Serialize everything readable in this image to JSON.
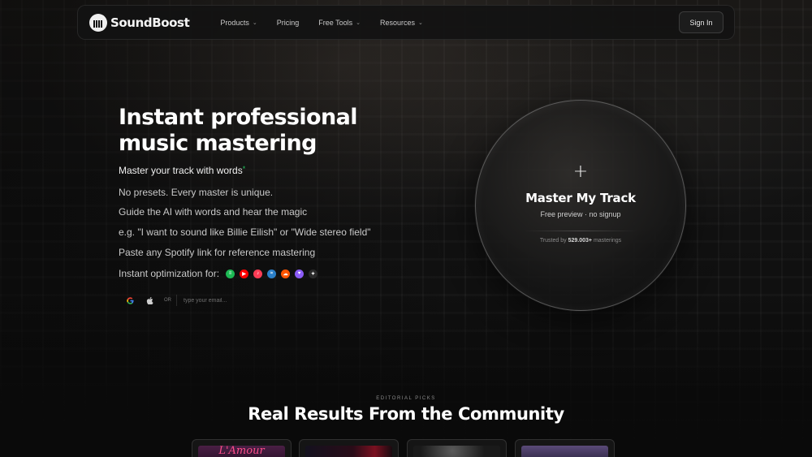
{
  "nav": {
    "brand": "SoundBoost",
    "items": [
      {
        "label": "Products",
        "has_dropdown": true
      },
      {
        "label": "Pricing",
        "has_dropdown": false
      },
      {
        "label": "Free Tools",
        "has_dropdown": true
      },
      {
        "label": "Resources",
        "has_dropdown": true
      }
    ],
    "chevron": "⌄",
    "signin_label": "Sign In"
  },
  "hero": {
    "title": "Instant professional music mastering",
    "subhead": "Master your track with words",
    "subhead_mark": "*",
    "features": [
      "No presets. Every master is unique.",
      "Guide the AI with words and hear the magic",
      "e.g. \"I want to sound like Billie Eilish\" or \"Wide stereo field\"",
      "Paste any Spotify link for reference mastering"
    ],
    "optimization_label": "Instant optimization for:",
    "services": [
      {
        "name": "spotify-icon",
        "color": "#1db954",
        "glyph": "≡"
      },
      {
        "name": "youtube-icon",
        "color": "#ff0000",
        "glyph": "▶"
      },
      {
        "name": "apple-music-icon",
        "color": "#fa3c55",
        "glyph": "♪"
      },
      {
        "name": "deezer-icon",
        "color": "#2b7fc8",
        "glyph": "≈"
      },
      {
        "name": "soundcloud-icon",
        "color": "#ff5500",
        "glyph": "☁"
      },
      {
        "name": "heart-icon",
        "color": "#8b5cf6",
        "glyph": "♥"
      },
      {
        "name": "tidal-icon",
        "color": "#2a2a2a",
        "glyph": "✦"
      }
    ]
  },
  "signup": {
    "or_label": "OR",
    "email_placeholder": "type your email..."
  },
  "upload": {
    "plus": "+",
    "title": "Master My Track",
    "subtitle": "Free preview · no signup",
    "trust_prefix": "Trusted by",
    "trust_count": "529.003+",
    "trust_suffix": "masterings"
  },
  "community": {
    "eyebrow": "EDITORIAL PICKS",
    "title": "Real Results From the Community",
    "cards": [
      {
        "label": "L'Amour",
        "art_color": "#3a1a3a"
      },
      {
        "label": "",
        "art_color": "#2b0f18"
      },
      {
        "label": "",
        "art_color": "#1e1e1e"
      },
      {
        "label": "",
        "art_color": "#3a3150"
      }
    ]
  },
  "colors": {
    "accent_green": "#22c55e",
    "background": "#0b0b0c"
  }
}
